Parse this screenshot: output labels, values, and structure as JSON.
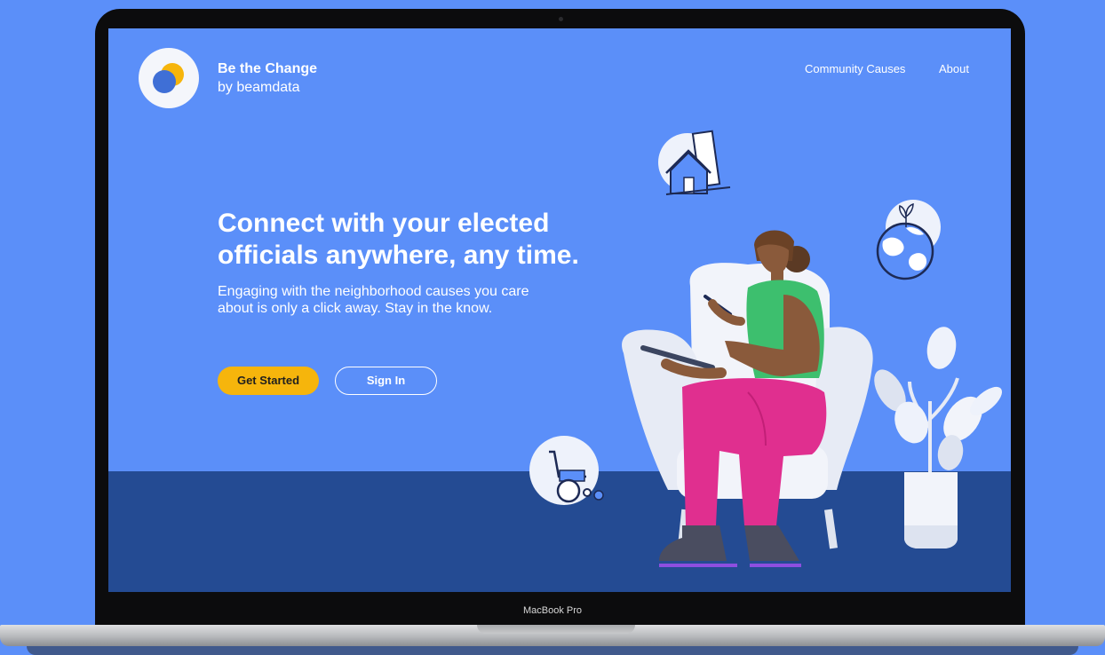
{
  "header": {
    "brand_title": "Be the Change",
    "brand_subtitle": "by beamdata",
    "nav": [
      "Community Causes",
      "About"
    ]
  },
  "hero": {
    "headline_line1": "Connect with your elected",
    "headline_line2": "officials anywhere, any time.",
    "subcopy_line1": "Engaging with the neighborhood causes you care",
    "subcopy_line2": "about is only a click away. Stay in the know.",
    "primary_cta": "Get Started",
    "secondary_cta": "Sign In"
  },
  "device": {
    "label": "MacBook Pro"
  },
  "colors": {
    "background": "#5b8ff9",
    "floor": "#244b93",
    "accent": "#f6b50c",
    "shirt": "#3dbf6e",
    "pants": "#e02f8f"
  },
  "icons": [
    "logo-icon",
    "house-icon",
    "globe-icon",
    "wheelchair-icon",
    "person-illustration",
    "plant-illustration"
  ]
}
